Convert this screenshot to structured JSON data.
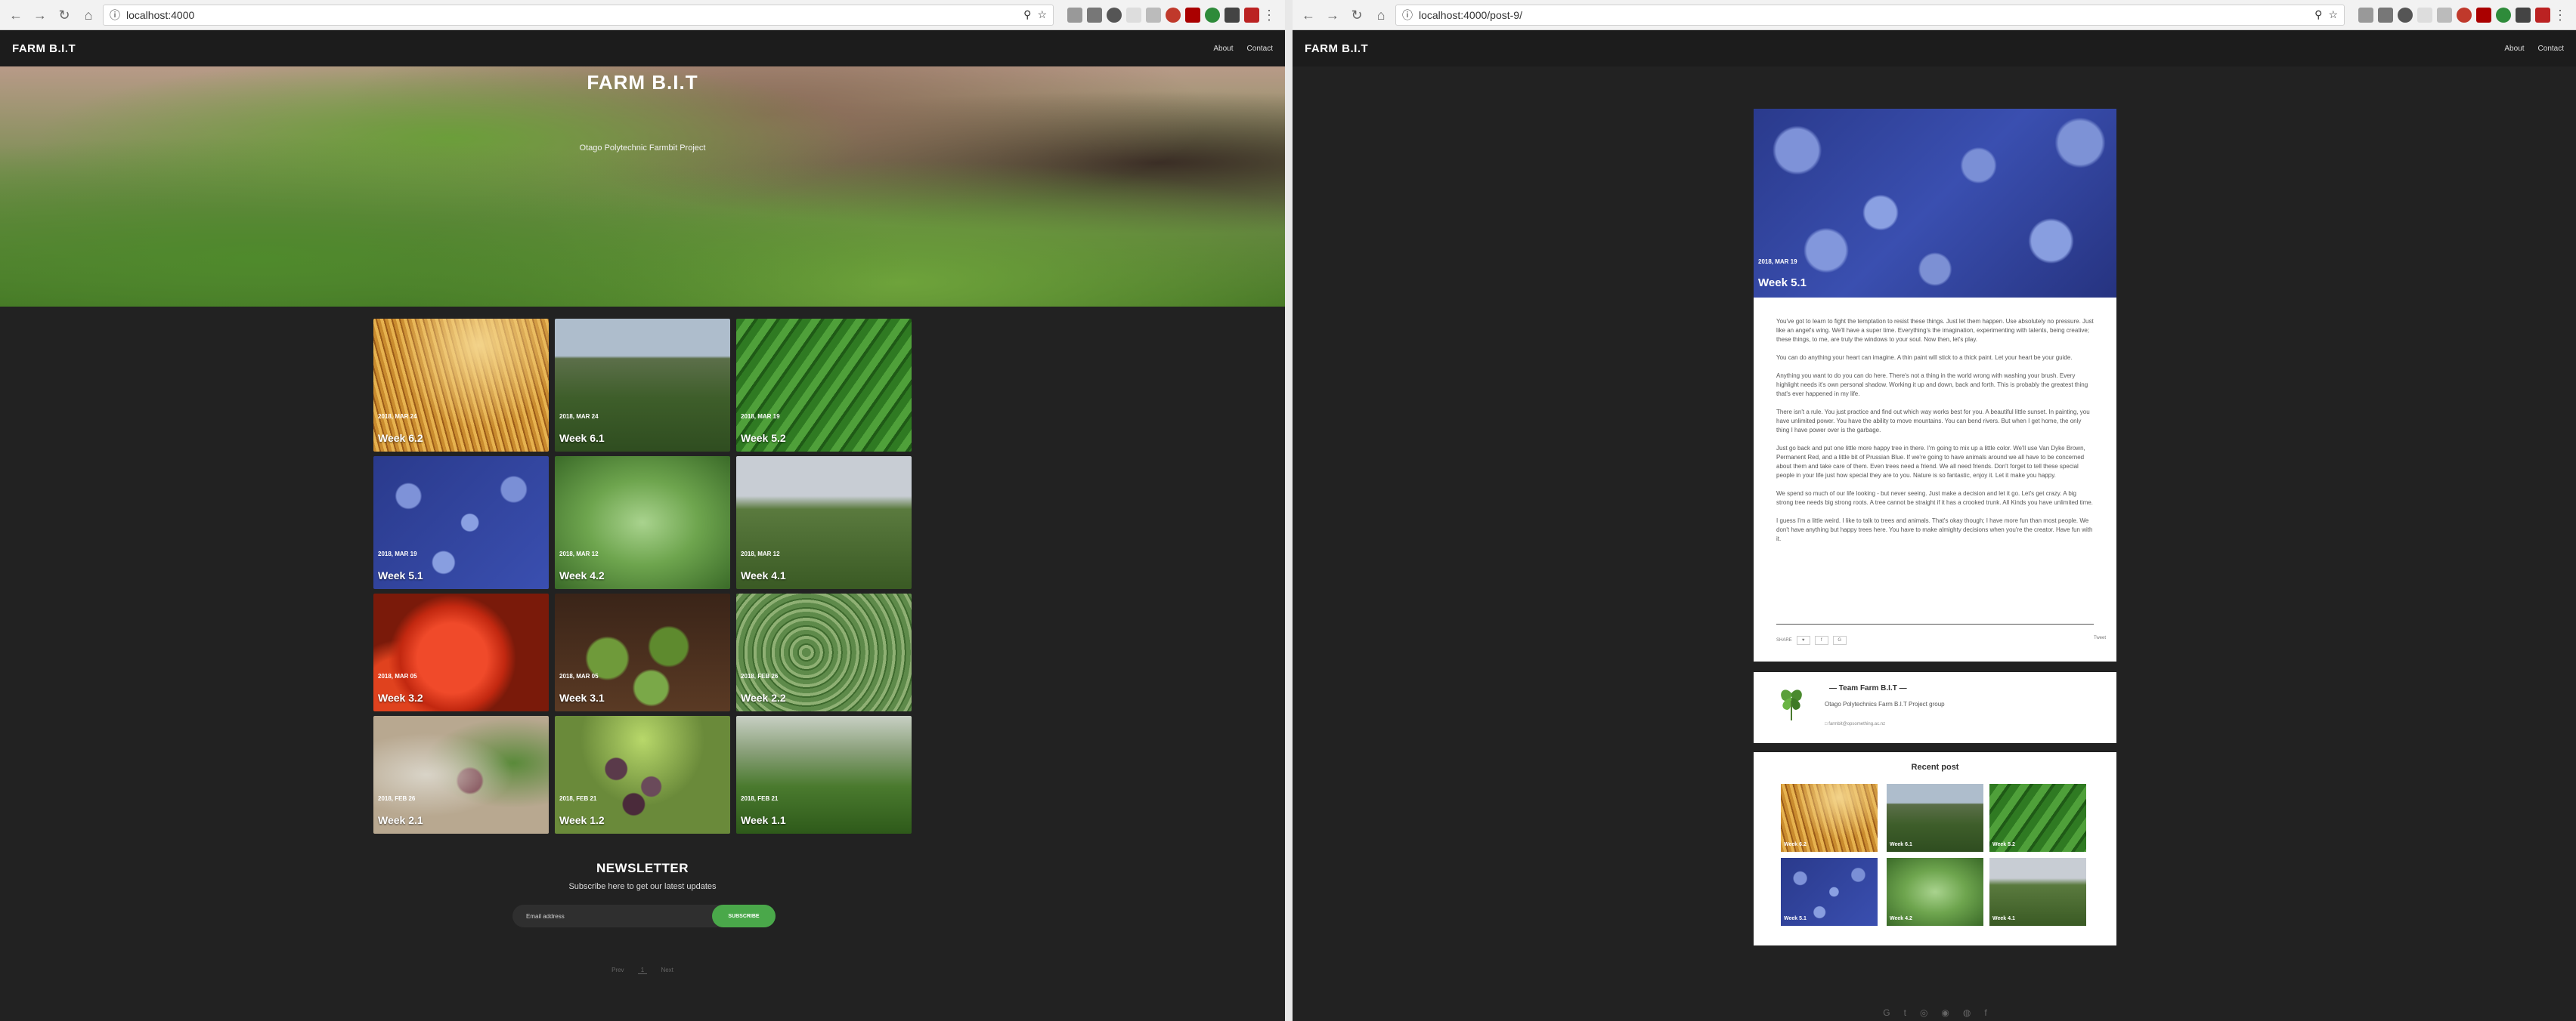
{
  "left": {
    "url": "localhost:4000",
    "brand": "FARM B.I.T",
    "nav": [
      "About",
      "Contact"
    ],
    "hero": {
      "title": "FARM B.I.T",
      "subtitle": "Otago Polytechnic Farmbit Project"
    },
    "posts": [
      {
        "date": "2018, MAR 24",
        "title": "Week 6.2",
        "image": "wheat"
      },
      {
        "date": "2018, MAR 24",
        "title": "Week 6.1",
        "image": "field"
      },
      {
        "date": "2018, MAR 19",
        "title": "Week 5.2",
        "image": "cucumber"
      },
      {
        "date": "2018, MAR 19",
        "title": "Week 5.1",
        "image": "blueberry"
      },
      {
        "date": "2018, MAR 12",
        "title": "Week 4.2",
        "image": "leaf"
      },
      {
        "date": "2018, MAR 12",
        "title": "Week 4.1",
        "image": "cow"
      },
      {
        "date": "2018, MAR 05",
        "title": "Week 3.2",
        "image": "tomato"
      },
      {
        "date": "2018, MAR 05",
        "title": "Week 3.1",
        "image": "sprouts"
      },
      {
        "date": "2018, FEB 26",
        "title": "Week 2.2",
        "image": "artichoke"
      },
      {
        "date": "2018, FEB 26",
        "title": "Week 2.1",
        "image": "herbs"
      },
      {
        "date": "2018, FEB 21",
        "title": "Week 1.2",
        "image": "grapes"
      },
      {
        "date": "2018, FEB 21",
        "title": "Week 1.1",
        "image": "lettuce"
      }
    ],
    "newsletter": {
      "title": "NEWSLETTER",
      "subtitle": "Subscribe here to get our latest updates",
      "placeholder": "Email address",
      "button": "SUBSCRIBE"
    },
    "pagination": {
      "prev": "Prev",
      "current": "1",
      "next": "Next"
    }
  },
  "right": {
    "url": "localhost:4000/post-9/",
    "brand": "FARM B.I.T",
    "nav": [
      "About",
      "Contact"
    ],
    "post": {
      "date": "2018, MAR 19",
      "title": "Week 5.1",
      "paragraphs": [
        "You've got to learn to fight the temptation to resist these things. Just let them happen. Use absolutely no pressure. Just like an angel's wing. We'll have a super time. Everything's the imagination, experimenting with talents, being creative; these things, to me, are truly the windows to your soul. Now then, let's play.",
        "You can do anything your heart can imagine. A thin paint will stick to a thick paint. Let your heart be your guide.",
        "Anything you want to do you can do here. There's not a thing in the world wrong with washing your brush. Every highlight needs it's own personal shadow. Working it up and down, back and forth. This is probably the greatest thing that's ever happened in my life.",
        "There isn't a rule. You just practice and find out which way works best for you. A beautiful little sunset. In painting, you have unlimited power. You have the ability to move mountains. You can bend rivers. But when I get home, the only thing I have power over is the garbage.",
        "Just go back and put one little more happy tree in there. I'm going to mix up a little color. We'll use Van Dyke Brown, Permanent Red, and a little bit of Prussian Blue. If we're going to have animals around we all have to be concerned about them and take care of them. Even trees need a friend. We all need friends. Don't forget to tell these special people in your life just how special they are to you. Nature is so fantastic, enjoy it. Let it make you happy.",
        "We spend so much of our life looking - but never seeing. Just make a decision and let it go. Let's get crazy. A big strong tree needs big strong roots. A tree cannot be straight if it has a crooked trunk. All Kinds you have unlimited time.",
        "I guess I'm a little weird. I like to talk to trees and animals. That's okay though; I have more fun than most people. We don't have anything but happy trees here. You have to make almighty decisions when you're the creator. Have fun with it."
      ],
      "share_label": "SHARE",
      "share_buttons": [
        "♥",
        "f",
        "G"
      ],
      "share_right": "Tweet"
    },
    "author": {
      "name": "— Team Farm B.I.T —",
      "desc": "Otago Polytechnics Farm B.I.T Project group",
      "link": "□ farmbit@opsomething.ac.nz"
    },
    "recent": {
      "title": "Recent post",
      "items": [
        {
          "title": "Week 6.2",
          "image": "wheat"
        },
        {
          "title": "Week 6.1",
          "image": "field"
        },
        {
          "title": "Week 5.2",
          "image": "cucumber"
        },
        {
          "title": "Week 5.1",
          "image": "blueberry"
        },
        {
          "title": "Week 4.2",
          "image": "leaf"
        },
        {
          "title": "Week 4.1",
          "image": "cow"
        }
      ]
    },
    "footer_icons": [
      "G",
      "t",
      "◎",
      "◉",
      "◍",
      "f"
    ]
  }
}
